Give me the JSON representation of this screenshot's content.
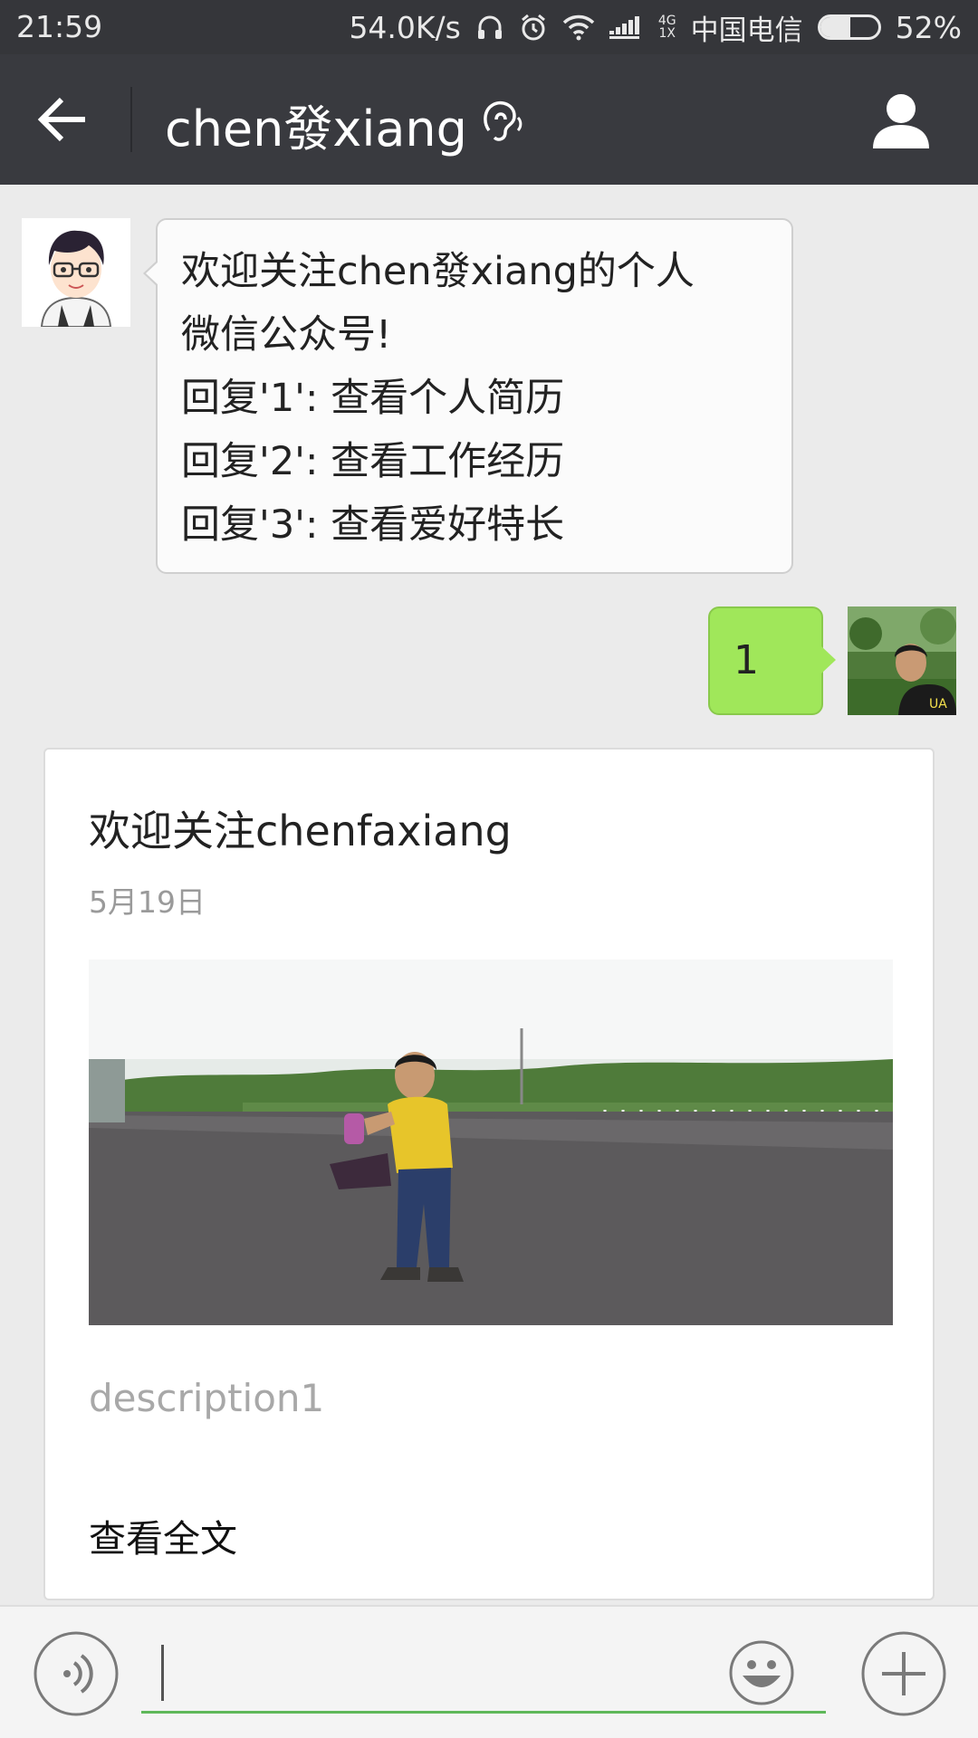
{
  "status_bar": {
    "time": "21:59",
    "net_speed": "54.0K/s",
    "network_type_top": "4G",
    "network_type_bottom": "1X",
    "carrier": "中国电信",
    "battery": "52%",
    "battery_level": 0.52,
    "icons": [
      "headphones-icon",
      "alarm-icon",
      "wifi-icon",
      "signal-icon",
      "battery-icon"
    ]
  },
  "header": {
    "title": "chen發xiang",
    "back_icon": "arrow-left-icon",
    "earpiece_icon": "earpiece-mode-icon",
    "profile_icon": "person-icon"
  },
  "messages": [
    {
      "side": "left",
      "avatar": "cartoon-boy-avatar",
      "lines": [
        "欢迎关注chen發xiang的个人",
        "微信公众号!",
        "回复'1': 查看个人简历",
        "回复'2': 查看工作经历",
        "回复'3': 查看爱好特长"
      ]
    },
    {
      "side": "right",
      "avatar": "user-photo-avatar",
      "text": "1"
    }
  ],
  "article_card": {
    "title": "欢迎关注chenfaxiang",
    "date": "5月19日",
    "image": "man-on-road-photo",
    "description": "description1",
    "read_more": "查看全文"
  },
  "input_bar": {
    "voice_icon": "voice-icon",
    "emoji_icon": "emoji-icon",
    "plus_icon": "plus-icon",
    "value": ""
  },
  "colors": {
    "title_bar": "#393a3f",
    "status_bar": "#35363a",
    "chat_bg": "#ebebeb",
    "sent_bubble": "#a0e75a",
    "input_underline": "#5fb85a"
  }
}
